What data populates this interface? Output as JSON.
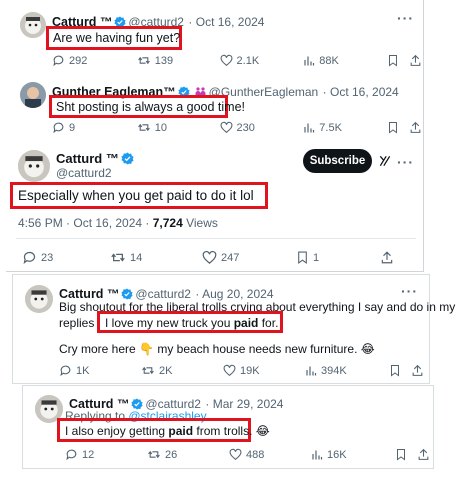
{
  "tweet1": {
    "name": "Catturd ™",
    "handle": "@catturd2",
    "date": "· Oct 16, 2024",
    "text": "Are we having fun yet?",
    "replies": "292",
    "retweets": "139",
    "likes": "2.1K",
    "views": "88K"
  },
  "tweet2": {
    "name": "Gunther Eagleman™",
    "handle": "@GuntherEagleman",
    "date": "· Oct 16, 2024",
    "text": "Sht posting is always a good time!",
    "replies": "9",
    "retweets": "10",
    "likes": "230",
    "views": "7.5K"
  },
  "tweet3": {
    "name": "Catturd ™",
    "handle": "@catturd2",
    "subscribe_label": "Subscribe",
    "text": "Especially when you get paid to do it lol",
    "time_date": "4:56 PM · Oct 16, 2024 · ",
    "views_count": "7,724",
    "views_label": " Views",
    "replies": "23",
    "retweets": "14",
    "likes": "247",
    "bookmarks": "1"
  },
  "tweet4": {
    "name": "Catturd ™",
    "handle": "@catturd2",
    "date": "· Aug 20, 2024",
    "line1": "Big shoutout for the liberal trolls crying about everything I say and do in my",
    "line2_prefix": "replies",
    "line2_boxed_a": "I love my new truck you ",
    "line2_boxed_bold": "paid",
    "line2_boxed_b": " for.",
    "line3_a": "Cry more here ",
    "line3_emoji": "👇",
    "line3_b": " my beach house needs new furniture. ",
    "line3_emoji2": "😂",
    "replies": "1K",
    "retweets": "2K",
    "likes": "19K",
    "views": "394K"
  },
  "tweet5": {
    "name": "Catturd ™",
    "handle": "@catturd2",
    "date": "· Mar 29, 2024",
    "replying_prefix": "Replying to ",
    "replying_handle": "@stclairashley",
    "text_a": "I also enjoy getting ",
    "text_bold": "paid",
    "text_b": " from trolls. ",
    "text_emoji": "😂",
    "replies": "12",
    "retweets": "26",
    "likes": "488",
    "views": "16K"
  },
  "colors": {
    "highlight_box": "#e0141e",
    "verified_blue": "#1d9bf0",
    "text_secondary": "#536471"
  },
  "icons": [
    "verified-badge-icon",
    "reply-icon",
    "retweet-icon",
    "like-icon",
    "views-icon",
    "bookmark-icon",
    "share-icon",
    "more-icon",
    "grok-icon"
  ]
}
